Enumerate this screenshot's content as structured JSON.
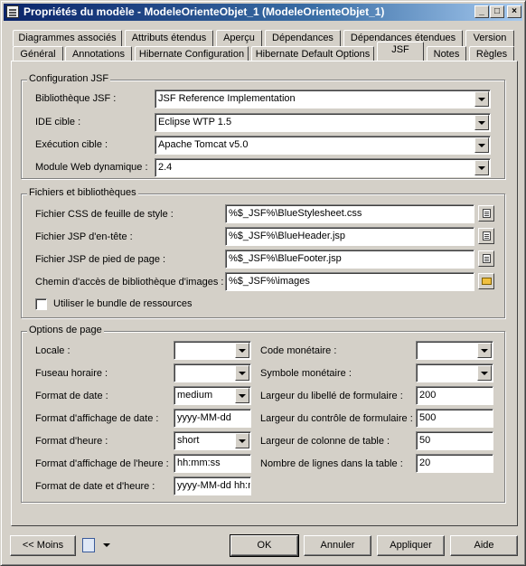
{
  "window": {
    "title": "Propriétés du modèle - ModeleOrienteObjet_1 (ModeleOrienteObjet_1)",
    "minimize": "_",
    "maximize": "□",
    "close": "×"
  },
  "tabs_row1": [
    "Diagrammes associés",
    "Attributs étendus",
    "Aperçu",
    "Dépendances",
    "Dépendances étendues",
    "Version"
  ],
  "tabs_row2": [
    "Général",
    "Annotations",
    "Hibernate Configuration",
    "Hibernate Default Options",
    "JSF",
    "Notes",
    "Règles"
  ],
  "active_tab": "JSF",
  "jsf_config": {
    "group_label": "Configuration JSF",
    "library_label": "Bibliothèque JSF :",
    "library_value": "JSF Reference Implementation",
    "ide_label": "IDE cible :",
    "ide_value": "Eclipse WTP 1.5",
    "runtime_label": "Exécution cible :",
    "runtime_value": "Apache Tomcat v5.0",
    "webmodule_label": "Module Web dynamique :",
    "webmodule_value": "2.4"
  },
  "files": {
    "group_label": "Fichiers et bibliothèques",
    "css_label": "Fichier CSS de feuille de style :",
    "css_value": "%$_JSF%\\BlueStylesheet.css",
    "header_label": "Fichier JSP d'en-tête :",
    "header_value": "%$_JSF%\\BlueHeader.jsp",
    "footer_label": "Fichier JSP de pied de page :",
    "footer_value": "%$_JSF%\\BlueFooter.jsp",
    "images_label": "Chemin d'accès de bibliothèque d'images :",
    "images_value": "%$_JSF%\\images",
    "bundle_label": "Utiliser le bundle de ressources",
    "bundle_checked": false
  },
  "page_options": {
    "group_label": "Options de page",
    "locale_label": "Locale :",
    "locale_value": "",
    "timezone_label": "Fuseau horaire :",
    "timezone_value": "",
    "date_format_label": "Format de date :",
    "date_format_value": "medium",
    "date_display_label": "Format d'affichage de date :",
    "date_display_value": "yyyy-MM-dd",
    "time_format_label": "Format d'heure :",
    "time_format_value": "short",
    "time_display_label": "Format d'affichage de l'heure :",
    "time_display_value": "hh:mm:ss",
    "datetime_label": "Format de date et d'heure :",
    "datetime_value": "yyyy-MM-dd hh:mm",
    "currency_code_label": "Code monétaire :",
    "currency_code_value": "",
    "currency_symbol_label": "Symbole monétaire :",
    "currency_symbol_value": "",
    "form_label_width_label": "Largeur du libellé de formulaire :",
    "form_label_width_value": "200",
    "form_control_width_label": "Largeur du contrôle de formulaire :",
    "form_control_width_value": "500",
    "table_col_width_label": "Largeur de colonne de table :",
    "table_col_width_value": "50",
    "table_rows_label": "Nombre de lignes dans la table :",
    "table_rows_value": "20"
  },
  "footer": {
    "less_label": "<< Moins",
    "ok_label": "OK",
    "cancel_label": "Annuler",
    "apply_label": "Appliquer",
    "help_label": "Aide"
  }
}
